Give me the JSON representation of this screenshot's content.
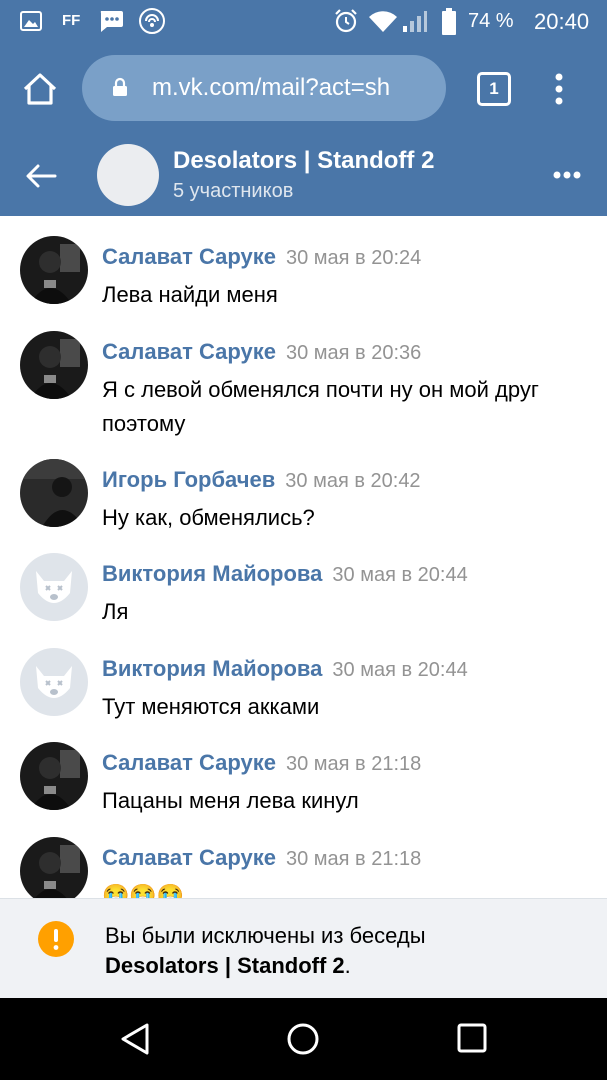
{
  "status_bar": {
    "left_icons": [
      "image-icon",
      "ff-icon",
      "message-icon",
      "hotspot-icon"
    ],
    "ff_label": "FF",
    "battery": "74 %",
    "time": "20:40"
  },
  "browser": {
    "url": "m.vk.com/mail?act=sh",
    "tab_count": "1"
  },
  "chat": {
    "title": "Desolators | Standoff 2",
    "subtitle": "5 участников"
  },
  "messages": [
    {
      "sender": "Салават Саруке",
      "time": "30 мая в 20:24",
      "text": "Лева найди меня",
      "avatar": "dark-photo"
    },
    {
      "sender": "Салават Саруке",
      "time": "30 мая в 20:36",
      "text": "Я с левой обменялся почти ну он мой друг поэтому",
      "avatar": "dark-photo"
    },
    {
      "sender": "Игорь Горбачев",
      "time": "30 мая в 20:42",
      "text": "Ну как, обменялись?",
      "avatar": "dark-photo-2"
    },
    {
      "sender": "Виктория Майорова",
      "time": "30 мая в 20:44",
      "text": "Ля",
      "avatar": "vk-dog"
    },
    {
      "sender": "Виктория Майорова",
      "time": "30 мая в 20:44",
      "text": "Тут меняются акками",
      "avatar": "vk-dog"
    },
    {
      "sender": "Салават Саруке",
      "time": "30 мая в 21:18",
      "text": "Пацаны меня лева кинул",
      "avatar": "dark-photo"
    },
    {
      "sender": "Салават Саруке",
      "time": "30 мая в 21:18",
      "text": "😭😭😭",
      "avatar": "dark-photo"
    }
  ],
  "notice": {
    "text_prefix": "Вы были исключены из беседы",
    "chat_name": "Desolators | Standoff 2",
    "suffix": "."
  },
  "colors": {
    "header": "#4a76a8",
    "sender": "#4a76a8",
    "warning": "#ffa000"
  }
}
